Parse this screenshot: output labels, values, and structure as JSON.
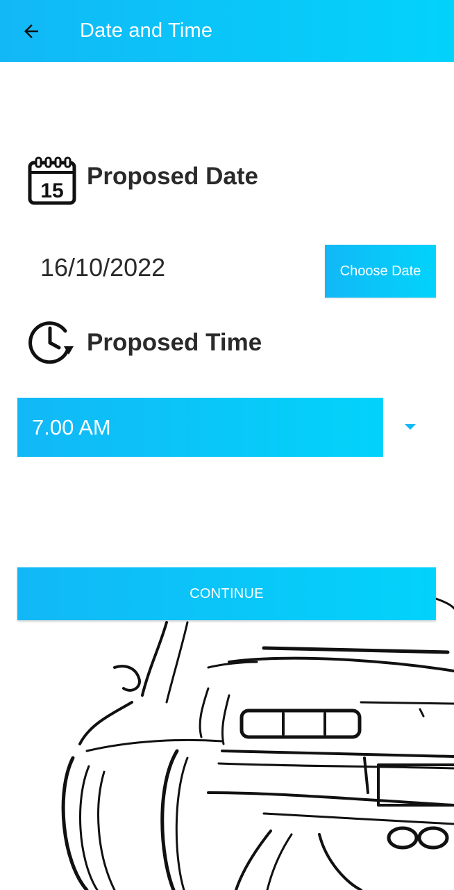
{
  "appbar": {
    "title": "Date and Time",
    "back_icon": "arrow-left-icon",
    "color_start": "#12b8f6",
    "color_end": "#02d3fb"
  },
  "date_section": {
    "title": "Proposed Date",
    "icon": "calendar-icon",
    "icon_day": "15",
    "value": "16/10/2022",
    "choose_button_label": "Choose Date"
  },
  "time_section": {
    "title": "Proposed Time",
    "icon": "clock-history-icon",
    "selected_time": "7.00 AM",
    "dropdown_icon": "caret-down-icon",
    "dropdown_icon_color": "#12b8f6"
  },
  "continue_button_label": "CONTINUE",
  "illustration": "car-rear-line-drawing"
}
